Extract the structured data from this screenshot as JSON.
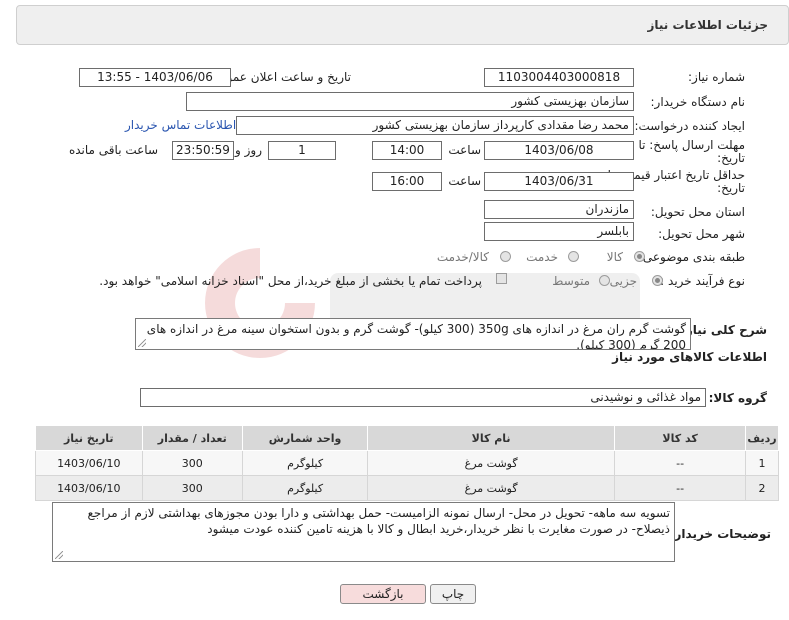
{
  "header": {
    "title": "جزئیات اطلاعات نیاز"
  },
  "labels": {
    "need_number": "شماره نیاز:",
    "announce_datetime": "تاریخ و ساعت اعلان عمومی:",
    "buyer_org": "نام دستگاه خریدار:",
    "requester": "ایجاد کننده درخواست:",
    "reply_deadline_1": "مهلت ارسال پاسخ: تا",
    "reply_deadline_2": "تاریخ:",
    "time_word": "ساعت",
    "day_word": "روز و",
    "remaining": "ساعت باقی مانده",
    "price_validity_1": "حداقل تاریخ اعتبار قیمت: تا",
    "price_validity_2": "تاریخ:",
    "delivery_province": "استان محل تحویل:",
    "delivery_city": "شهر محل تحویل:",
    "category": "طبقه بندی موضوعی:",
    "process_type": "نوع فرآیند خرید :",
    "description": "شرح کلی نیاز:",
    "goods_info": "اطلاعات کالاهای مورد نیاز",
    "goods_group": "گروه کالا:",
    "buyer_notes": "توضیحات خریدار:"
  },
  "values": {
    "need_number": "1103004403000818",
    "announce_datetime": "1403/06/06 - 13:55",
    "buyer_org": "سازمان بهزیستی کشور",
    "requester": "محمد رضا  مقدادی کارپرداز سازمان بهزیستی کشور",
    "contact_link": "اطلاعات تماس خریدار",
    "reply_date": "1403/06/08",
    "reply_time": "14:00",
    "reply_days": "1",
    "reply_remaining": "23:50:59",
    "validity_date": "1403/06/31",
    "validity_time": "16:00",
    "province": "مازندران",
    "city": "بابلسر",
    "goods_group": "مواد غذائی و نوشیدنی"
  },
  "category_options": [
    {
      "label": "کالا",
      "selected": true
    },
    {
      "label": "خدمت",
      "selected": false
    },
    {
      "label": "کالا/خدمت",
      "selected": false
    }
  ],
  "process_options": [
    {
      "label": "جزیی",
      "selected": true
    },
    {
      "label": "متوسط",
      "selected": false
    }
  ],
  "treasury_note": "پرداخت تمام یا بخشی از مبلغ خرید،از محل \"اسناد خزانه اسلامی\" خواهد بود.",
  "description_text": "گوشت گرم ران مرغ در اندازه های 350g (300 کیلو)- گوشت گرم و بدون استخوان سینه مرغ در اندازه های 200 گرم (300 کیلو).",
  "table": {
    "headers": [
      "ردیف",
      "کد کالا",
      "نام کالا",
      "واحد شمارش",
      "تعداد / مقدار",
      "تاریخ نیاز"
    ],
    "rows": [
      [
        "1",
        "--",
        "گوشت مرغ",
        "کیلوگرم",
        "300",
        "1403/06/10"
      ],
      [
        "2",
        "--",
        "گوشت مرغ",
        "کیلوگرم",
        "300",
        "1403/06/10"
      ]
    ]
  },
  "buyer_notes_text": "تسویه سه ماهه- تحویل در محل- ارسال نمونه الزامیست- حمل بهداشتی و دارا بودن مجوزهای بهداشتی لازم از مراجع ذیصلاح- در صورت مغایرت با نظر خریدار،خرید ابطال و کالا با هزینه تامین کننده عودت میشود",
  "buttons": {
    "print": "چاپ",
    "back": "بازگشت"
  },
  "colors": {
    "link": "#2b56b0",
    "back_button_bg": "#f7dcdc",
    "print_button_bg": "#f0f0f0"
  }
}
